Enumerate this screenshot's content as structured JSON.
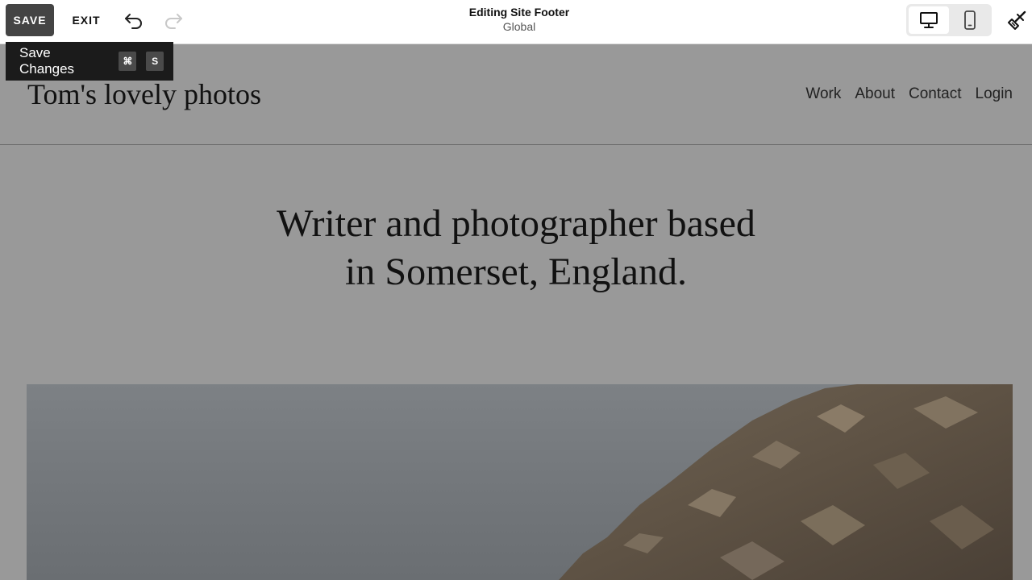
{
  "toolbar": {
    "save_label": "SAVE",
    "exit_label": "EXIT",
    "undo_icon": "undo-icon",
    "redo_icon": "redo-icon",
    "title": "Editing Site Footer",
    "subtitle": "Global",
    "desktop_icon": "desktop-icon",
    "mobile_icon": "mobile-icon",
    "design_icon": "paintbrush-icon"
  },
  "tooltip": {
    "label": "Save Changes",
    "keys": [
      "⌘",
      "S"
    ]
  },
  "site": {
    "title": "Tom's lovely photos",
    "nav": [
      "Work",
      "About",
      "Contact",
      "Login"
    ],
    "hero_line1": "Writer and photographer based",
    "hero_line2": "in Somerset, England."
  },
  "colors": {
    "overlay_gray": "#999999",
    "save_button": "#444444",
    "tooltip_bg": "#1b1b1b"
  }
}
